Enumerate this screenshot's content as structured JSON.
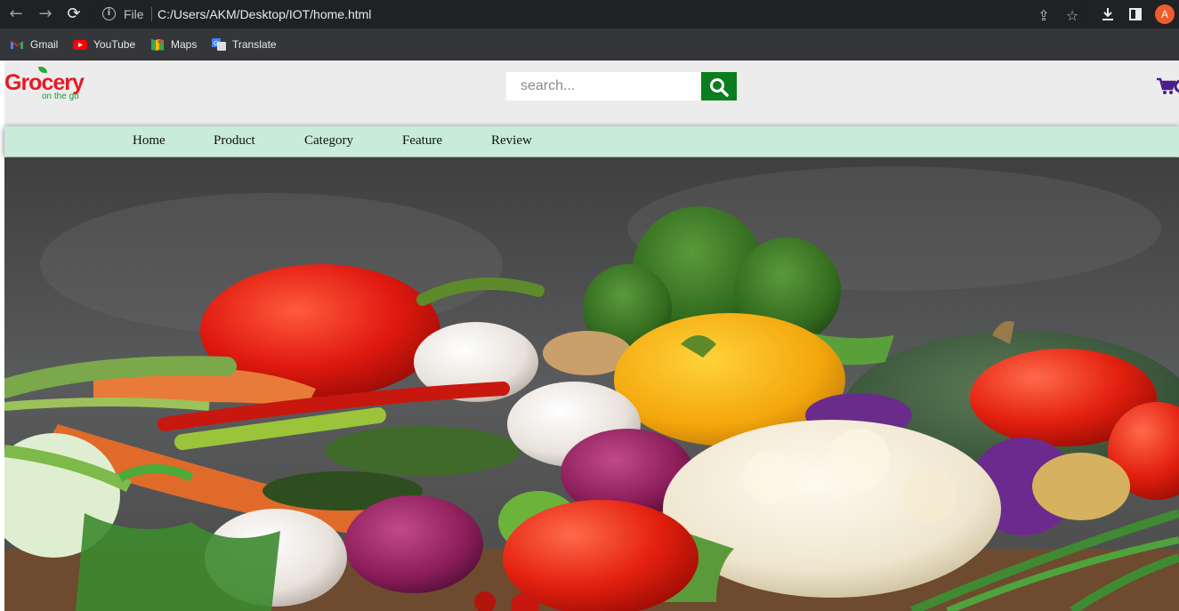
{
  "browser": {
    "omnibox": {
      "scheme_label": "File",
      "url": "C:/Users/AKM/Desktop/IOT/home.html"
    },
    "avatar_letter": "A",
    "bookmarks": [
      {
        "label": "Gmail",
        "icon": "gmail-icon"
      },
      {
        "label": "YouTube",
        "icon": "youtube-icon"
      },
      {
        "label": "Maps",
        "icon": "maps-icon"
      },
      {
        "label": "Translate",
        "icon": "translate-icon"
      }
    ]
  },
  "header": {
    "logo": {
      "word": "Grocery",
      "tagline": "on the go"
    },
    "search": {
      "placeholder": "search...",
      "value": ""
    },
    "cart": {
      "icon": "cart-icon"
    }
  },
  "nav": {
    "links": [
      "Home",
      "Product",
      "Category",
      "Feature",
      "Review"
    ]
  },
  "hero": {
    "image": "vegetables-photo"
  },
  "colors": {
    "brand_red": "#e31b23",
    "brand_green": "#0a7d1e",
    "nav_bg": "#c8ecd9",
    "cart_purple": "#4b1e8c"
  }
}
